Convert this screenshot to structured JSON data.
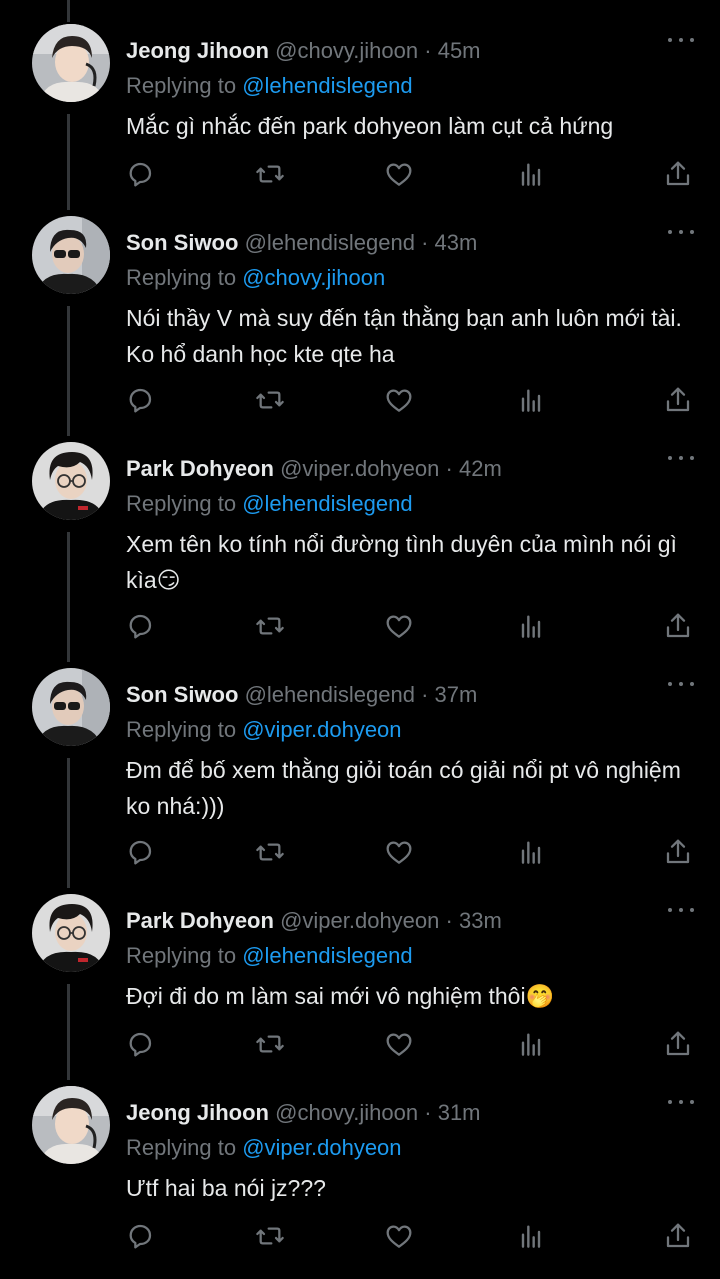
{
  "reply_prefix": "Replying to",
  "tweets": [
    {
      "name": "Jeong Jihoon",
      "handle": "@chovy.jihoon",
      "sep": "·",
      "time": "45m",
      "replying_to": "@lehendislegend",
      "text": "Mắc gì nhắc đến park dohyeon làm cụt cả hứng",
      "avatar": "chovy-avatar"
    },
    {
      "name": "Son Siwoo",
      "handle": "@lehendislegend",
      "sep": "·",
      "time": "43m",
      "replying_to": "@chovy.jihoon",
      "text": "Nói thầy V mà suy đến tận thằng bạn anh luôn mới tài. Ko hổ danh học kte qte ha",
      "avatar": "lehends-avatar"
    },
    {
      "name": "Park Dohyeon",
      "handle": "@viper.dohyeon",
      "sep": "·",
      "time": "42m",
      "replying_to": "@lehendislegend",
      "text": "Xem tên ko tính nổi đường tình duyên của mình nói gì kìa😏",
      "avatar": "viper-avatar"
    },
    {
      "name": "Son Siwoo",
      "handle": "@lehendislegend",
      "sep": "·",
      "time": "37m",
      "replying_to": "@viper.dohyeon",
      "text": "Đm để bố xem thằng giỏi toán có giải nổi pt vô nghiệm ko nhá:)))",
      "avatar": "lehends-avatar"
    },
    {
      "name": "Park Dohyeon",
      "handle": "@viper.dohyeon",
      "sep": "·",
      "time": "33m",
      "replying_to": "@lehendislegend",
      "text": "Đợi đi do m làm sai mới vô nghiệm thôi🤭",
      "avatar": "viper-avatar"
    },
    {
      "name": "Jeong Jihoon",
      "handle": "@chovy.jihoon",
      "sep": "·",
      "time": "31m",
      "replying_to": "@viper.dohyeon",
      "text": "Ư‌tf hai ba nói jz???",
      "avatar": "chovy-avatar"
    }
  ],
  "icons": {
    "reply": "reply-icon",
    "retweet": "retweet-icon",
    "like": "like-icon",
    "views": "views-icon",
    "share": "share-icon",
    "more": "more-icon"
  },
  "colors": {
    "background": "#000000",
    "text": "#e7e9ea",
    "muted": "#71767b",
    "link": "#1d9bf0",
    "thread_line": "#333639"
  }
}
